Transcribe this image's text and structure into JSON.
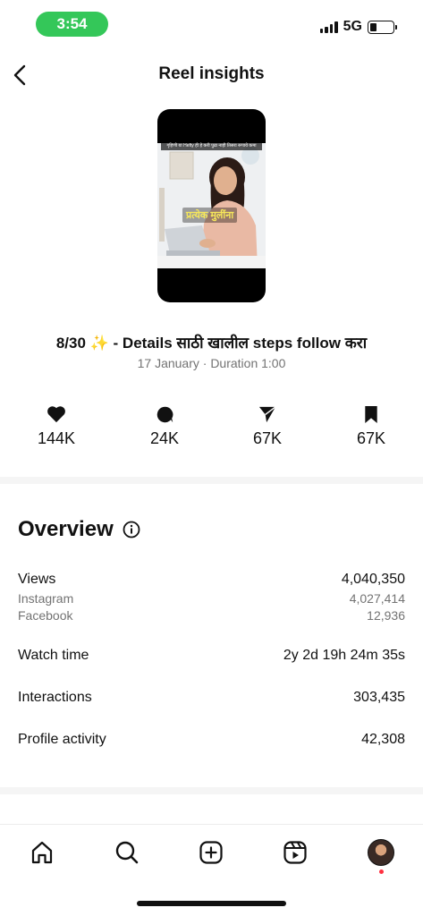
{
  "status_bar": {
    "time": "3:54",
    "network": "5G"
  },
  "header": {
    "title": "Reel insights"
  },
  "reel": {
    "caption_text": "गृहिणी या Hefty ही हे करी पुढा नाही तिसरा रूपाये कमा",
    "overlay_text": "प्रत्येक मुलींना",
    "title": "8/30 ✨ - Details साठी खालील steps follow करा",
    "meta": "17 January · Duration 1:00"
  },
  "stats": [
    {
      "icon": "heart-icon",
      "value": "144K"
    },
    {
      "icon": "comment-icon",
      "value": "24K"
    },
    {
      "icon": "share-icon",
      "value": "67K"
    },
    {
      "icon": "bookmark-icon",
      "value": "67K"
    }
  ],
  "overview": {
    "title": "Overview",
    "views_label": "Views",
    "views_value": "4,040,350",
    "instagram_label": "Instagram",
    "instagram_value": "4,027,414",
    "facebook_label": "Facebook",
    "facebook_value": "12,936",
    "watch_label": "Watch time",
    "watch_value": "2y 2d 19h 24m 35s",
    "interactions_label": "Interactions",
    "interactions_value": "303,435",
    "profile_label": "Profile activity",
    "profile_value": "42,308"
  },
  "colors": {
    "time_pill": "#34c759",
    "notification_dot": "#ff3040",
    "overlay_text": "#f7e85a"
  }
}
